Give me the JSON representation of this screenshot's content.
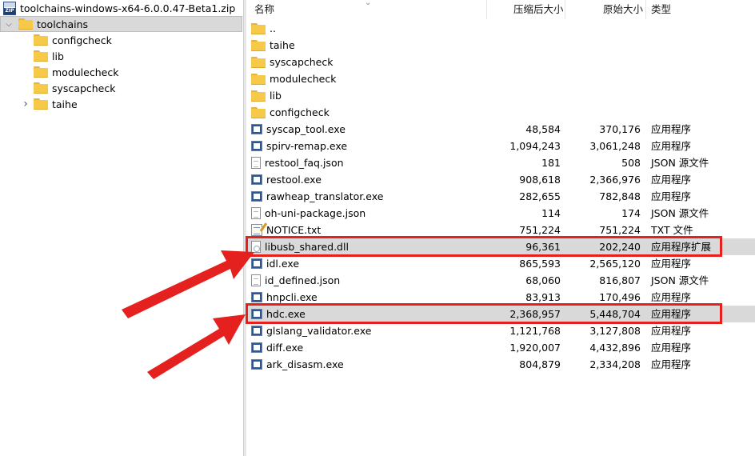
{
  "tree": {
    "root_label": "toolchains-windows-x64-6.0.0.47-Beta1.zip",
    "root_icon_text": "ZIP",
    "selected_label": "toolchains",
    "children": [
      {
        "label": "configcheck",
        "expandable": false
      },
      {
        "label": "lib",
        "expandable": false
      },
      {
        "label": "modulecheck",
        "expandable": false
      },
      {
        "label": "syscapcheck",
        "expandable": false
      },
      {
        "label": "taihe",
        "expandable": true
      }
    ]
  },
  "columns": {
    "name": "名称",
    "compressed": "压缩后大小",
    "original": "原始大小",
    "type": "类型"
  },
  "rows": [
    {
      "name": "..",
      "icon": "folder-icon",
      "compressed": "",
      "original": "",
      "type": ""
    },
    {
      "name": "taihe",
      "icon": "folder-icon",
      "compressed": "",
      "original": "",
      "type": ""
    },
    {
      "name": "syscapcheck",
      "icon": "folder-icon",
      "compressed": "",
      "original": "",
      "type": ""
    },
    {
      "name": "modulecheck",
      "icon": "folder-icon",
      "compressed": "",
      "original": "",
      "type": ""
    },
    {
      "name": "lib",
      "icon": "folder-icon",
      "compressed": "",
      "original": "",
      "type": ""
    },
    {
      "name": "configcheck",
      "icon": "folder-icon",
      "compressed": "",
      "original": "",
      "type": ""
    },
    {
      "name": "syscap_tool.exe",
      "icon": "exe-icon",
      "compressed": "48,584",
      "original": "370,176",
      "type": "应用程序"
    },
    {
      "name": "spirv-remap.exe",
      "icon": "exe-icon",
      "compressed": "1,094,243",
      "original": "3,061,248",
      "type": "应用程序"
    },
    {
      "name": "restool_faq.json",
      "icon": "json-file-icon",
      "compressed": "181",
      "original": "508",
      "type": "JSON 源文件"
    },
    {
      "name": "restool.exe",
      "icon": "exe-icon",
      "compressed": "908,618",
      "original": "2,366,976",
      "type": "应用程序"
    },
    {
      "name": "rawheap_translator.exe",
      "icon": "exe-icon",
      "compressed": "282,655",
      "original": "782,848",
      "type": "应用程序"
    },
    {
      "name": "oh-uni-package.json",
      "icon": "json-file-icon",
      "compressed": "114",
      "original": "174",
      "type": "JSON 源文件"
    },
    {
      "name": "NOTICE.txt",
      "icon": "txt-file-icon",
      "compressed": "751,224",
      "original": "751,224",
      "type": "TXT 文件"
    },
    {
      "name": "libusb_shared.dll",
      "icon": "dll-file-icon",
      "compressed": "96,361",
      "original": "202,240",
      "type": "应用程序扩展"
    },
    {
      "name": "idl.exe",
      "icon": "exe-icon",
      "compressed": "865,593",
      "original": "2,565,120",
      "type": "应用程序"
    },
    {
      "name": "id_defined.json",
      "icon": "json-file-icon",
      "compressed": "68,060",
      "original": "816,807",
      "type": "JSON 源文件"
    },
    {
      "name": "hnpcli.exe",
      "icon": "exe-icon",
      "compressed": "83,913",
      "original": "170,496",
      "type": "应用程序"
    },
    {
      "name": "hdc.exe",
      "icon": "exe-icon",
      "compressed": "2,368,957",
      "original": "5,448,704",
      "type": "应用程序"
    },
    {
      "name": "glslang_validator.exe",
      "icon": "exe-icon",
      "compressed": "1,121,768",
      "original": "3,127,808",
      "type": "应用程序"
    },
    {
      "name": "diff.exe",
      "icon": "exe-icon",
      "compressed": "1,920,007",
      "original": "4,432,896",
      "type": "应用程序"
    },
    {
      "name": "ark_disasm.exe",
      "icon": "exe-icon",
      "compressed": "804,879",
      "original": "2,334,208",
      "type": "应用程序"
    }
  ],
  "highlighted_rows": [
    "libusb_shared.dll",
    "hdc.exe"
  ],
  "annotation_color": "#e5211f",
  "highlight_bg": "#d9d9d9"
}
